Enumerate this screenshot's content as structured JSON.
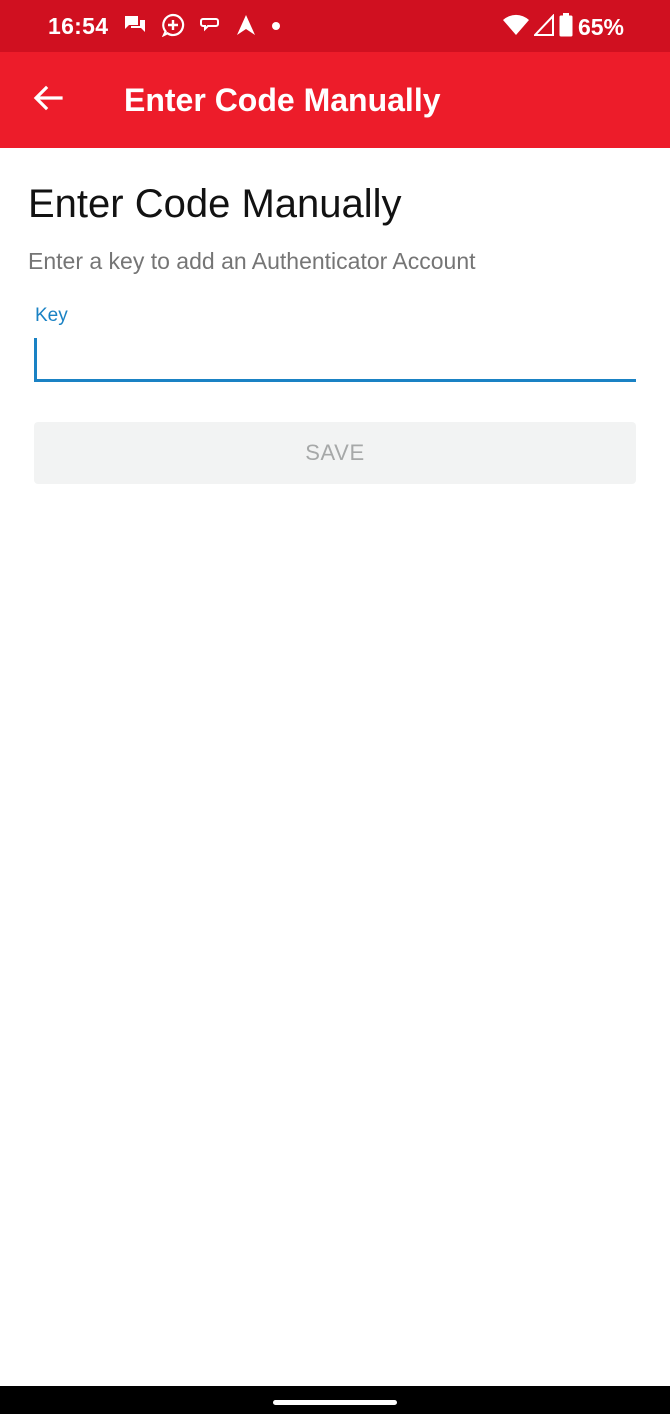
{
  "status_bar": {
    "time": "16:54",
    "battery_percent": "65%",
    "left_icons": [
      "chat-icon",
      "messenger-icon",
      "loop-icon",
      "navigation-icon",
      "dot-icon"
    ],
    "right_icons": [
      "wifi-icon",
      "signal-icon",
      "battery-icon"
    ],
    "background_color": "#d01020"
  },
  "app_bar": {
    "title": "Enter Code Manually",
    "back_icon": "arrow-left-icon",
    "background_color": "#ed1c2a"
  },
  "main": {
    "heading": "Enter Code Manually",
    "subtitle": "Enter a key to add an Authenticator Account",
    "key_field": {
      "label": "Key",
      "value": "",
      "accent_color": "#1a82c4"
    },
    "save_button": {
      "label": "SAVE",
      "enabled": false
    }
  }
}
